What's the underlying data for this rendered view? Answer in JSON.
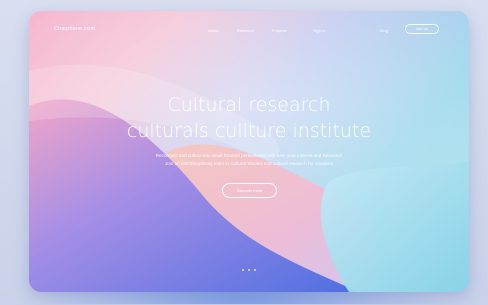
{
  "site": {
    "logo": "Cinephane.com"
  },
  "nav": {
    "links": [
      "About",
      "Research",
      "Projects",
      "Sign In"
    ],
    "extra": "Blog",
    "button_label": "Join Us"
  },
  "hero": {
    "title_line1": "Cultural  research",
    "title_line2": "culturals cullture institute",
    "subtitle_line1": "Reconnect and culture into small focused perfectionist with here your interest and Research",
    "subtitle_line2": "Join an interdisciplinary team in Cultural Studies and cultural research for creatives",
    "cta_label": "Discover more"
  },
  "colors": {
    "pink": "#f6b6cf",
    "lavender": "#bfc9f0",
    "cyan": "#9fd9ec",
    "blue": "#5f7fe6",
    "peach": "#f7c6a9"
  }
}
